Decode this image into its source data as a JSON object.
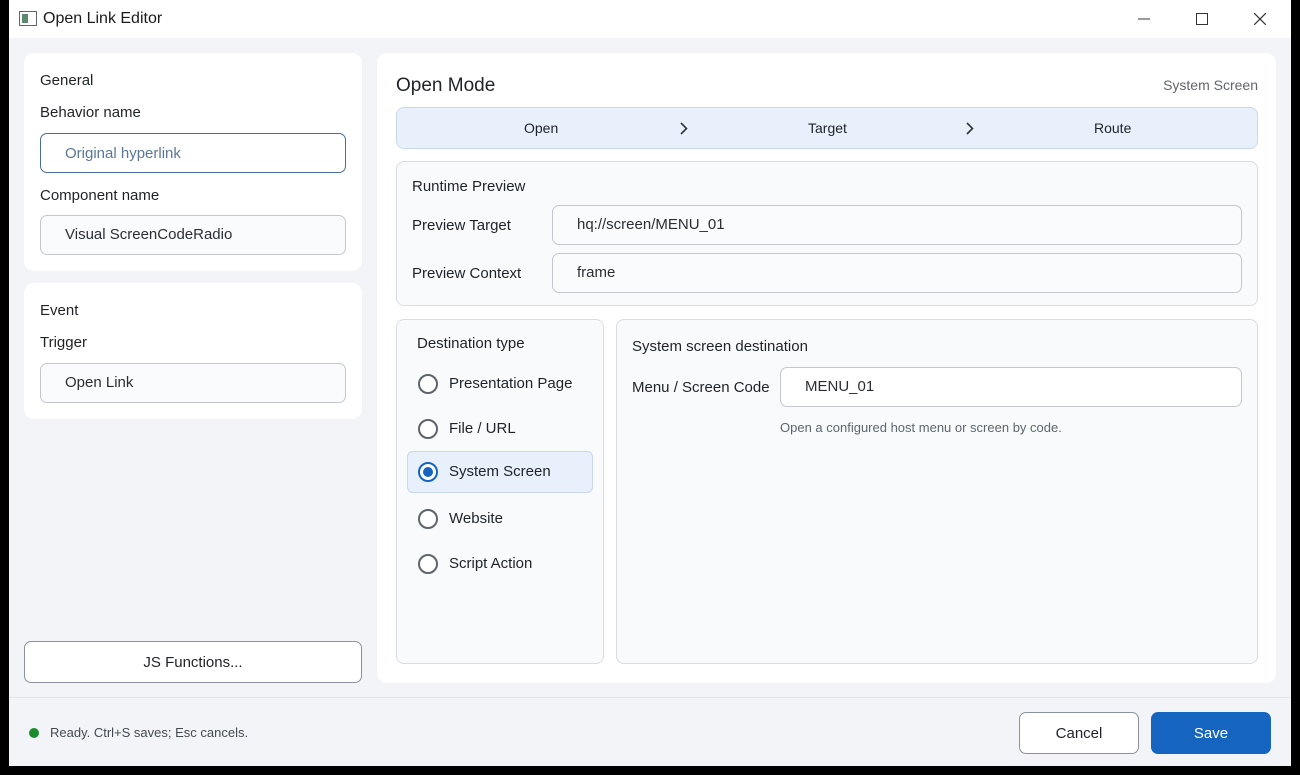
{
  "window": {
    "title": "Open Link Editor"
  },
  "general": {
    "section_title": "General",
    "behavior_label": "Behavior name",
    "behavior_placeholder": "Original hyperlink",
    "component_label": "Component name",
    "component_value": "Visual ScreenCodeRadio"
  },
  "event": {
    "section_title": "Event",
    "trigger_label": "Trigger",
    "trigger_value": "Open Link"
  },
  "js_button_label": "JS Functions...",
  "open_mode": {
    "title": "Open Mode",
    "current_mode": "System Screen",
    "steps": [
      "Open",
      "Target",
      "Route"
    ]
  },
  "preview": {
    "title": "Runtime Preview",
    "target_label": "Preview Target",
    "target_value": "hq://screen/MENU_01",
    "context_label": "Preview Context",
    "context_value": "frame"
  },
  "destination": {
    "title": "Destination type",
    "options": [
      "Presentation Page",
      "File / URL",
      "System Screen",
      "Website",
      "Script Action"
    ],
    "selected": "System Screen"
  },
  "system_screen": {
    "title": "System screen destination",
    "code_label": "Menu / Screen Code",
    "code_value": "MENU_01",
    "hint": "Open a configured host menu or screen by code."
  },
  "status": {
    "text": "Ready. Ctrl+S saves; Esc cancels.",
    "color": "#1c8a2e"
  },
  "footer": {
    "cancel_label": "Cancel",
    "save_label": "Save"
  },
  "colors": {
    "accent": "#1565c0",
    "step_bg": "#e7f0fb"
  }
}
